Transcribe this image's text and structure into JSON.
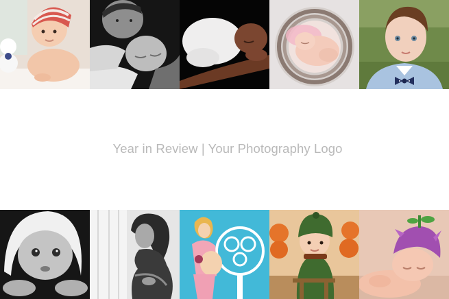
{
  "caption": "Year in Review | Your Photography Logo",
  "photos_top": [
    {
      "icon": "baby-in-striped-hat-photo",
      "palette": [
        "#e9dfd6",
        "#f2c6a9",
        "#d8584f"
      ]
    },
    {
      "icon": "father-holding-newborn-bw-photo",
      "palette": [
        "#111111",
        "#8a8a8a",
        "#d9d9d9"
      ]
    },
    {
      "icon": "sleeping-newborn-on-arm-photo",
      "palette": [
        "#050505",
        "#6b3a24",
        "#efeeee"
      ]
    },
    {
      "icon": "newborn-in-nest-basket-photo",
      "palette": [
        "#dedede",
        "#f4cbbb",
        "#8b7a72"
      ]
    },
    {
      "icon": "toddler-with-bow-tie-photo",
      "palette": [
        "#6f8a4a",
        "#f1d0bd",
        "#a9c3e0"
      ]
    }
  ],
  "photos_bottom": [
    {
      "icon": "baby-under-towel-bw-photo",
      "palette": [
        "#1a1a1a",
        "#bdbdbd",
        "#f0f0f0"
      ]
    },
    {
      "icon": "pregnant-woman-window-bw-photo",
      "palette": [
        "#dcdcdc",
        "#3a3a3a",
        "#9c9c9c"
      ]
    },
    {
      "icon": "pregnant-woman-tree-backdrop-photo",
      "palette": [
        "#3fb7d6",
        "#f2a6b7",
        "#f4d2b0"
      ]
    },
    {
      "icon": "baby-green-hat-pumpkins-photo",
      "palette": [
        "#e9c69b",
        "#e5742a",
        "#3f6b2f"
      ]
    },
    {
      "icon": "newborn-purple-flower-hat-photo",
      "palette": [
        "#e8c8b6",
        "#a14fb0",
        "#f3c1aa"
      ]
    }
  ]
}
